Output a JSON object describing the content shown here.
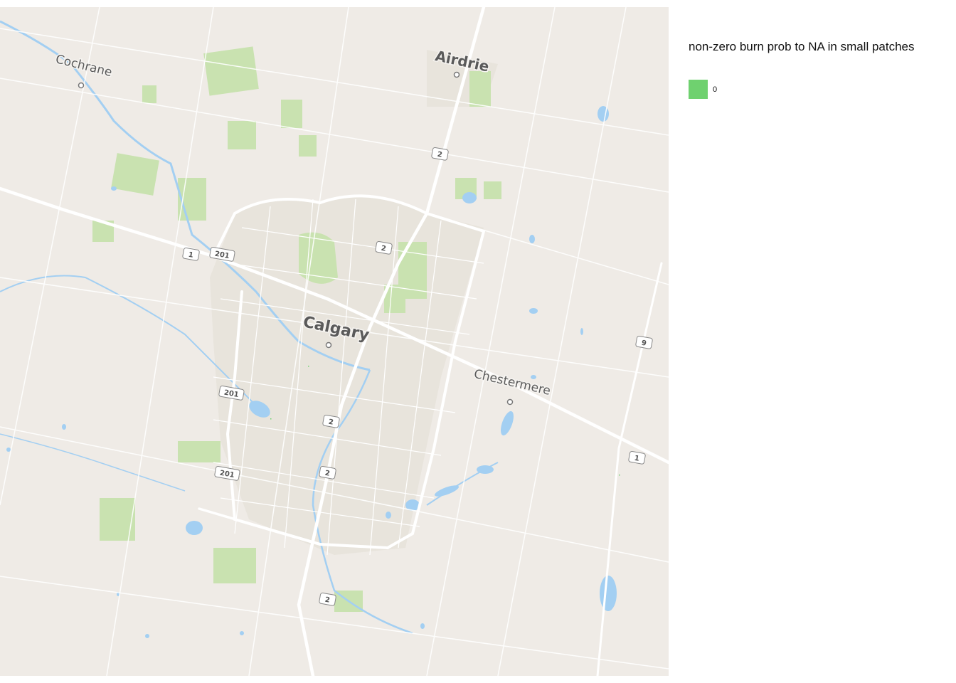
{
  "legend": {
    "title": "non-zero burn prob to NA in small patches",
    "items": [
      {
        "label": "0",
        "color": "#6fd16f"
      }
    ]
  },
  "map": {
    "basemap_colors": {
      "land": "#efebe6",
      "park": "#c9e2b0",
      "water": "#a3cff2",
      "road": "#ffffff",
      "urban": "#e8e4dc"
    },
    "places": {
      "calgary": "Calgary",
      "airdrie": "Airdrie",
      "cochrane": "Cochrane",
      "chestermere": "Chestermere"
    },
    "highway_shields": {
      "hwy1_a": "1",
      "hwy1_b": "1",
      "hwy201_a": "201",
      "hwy201_b": "201",
      "hwy201_c": "201",
      "hwy2_a": "2",
      "hwy2_b": "2",
      "hwy2_c": "2",
      "hwy2_d": "2",
      "hwy2_e": "2",
      "hwy9": "9"
    }
  }
}
